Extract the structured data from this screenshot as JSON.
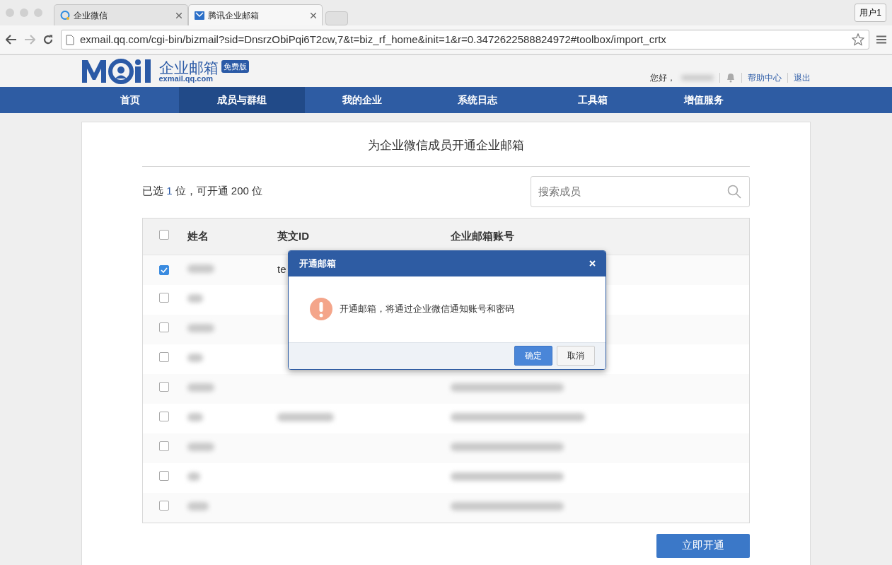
{
  "browser": {
    "tabs": [
      {
        "title": "企业微信",
        "selected": false
      },
      {
        "title": "腾讯企业邮箱",
        "selected": true
      }
    ],
    "profile_button": "用户1",
    "url": "exmail.qq.com/cgi-bin/bizmail?sid=DnsrzObiPqi6T2cw,7&t=biz_rf_home&init=1&r=0.3472622588824972#toolbox/import_crtx"
  },
  "header": {
    "logo_text": "企业邮箱",
    "logo_domain": "exmail.qq.com",
    "edition_badge": "免费版",
    "greeting": "您好，",
    "user_blurred": true,
    "links": [
      "帮助中心",
      "退出"
    ]
  },
  "nav": [
    {
      "label": "首页",
      "selected": false
    },
    {
      "label": "成员与群组",
      "selected": true
    },
    {
      "label": "我的企业",
      "selected": false
    },
    {
      "label": "系统日志",
      "selected": false
    },
    {
      "label": "工具箱",
      "selected": false
    },
    {
      "label": "增值服务",
      "selected": false
    }
  ],
  "page": {
    "title": "为企业微信成员开通企业邮箱",
    "counter": {
      "prefix": "已选 ",
      "selected_count": "1",
      "middle": " 位，可开通 ",
      "available": "200",
      "suffix": " 位"
    },
    "search": {
      "placeholder": "搜索成员"
    },
    "submit_button": "立即开通"
  },
  "table": {
    "select_all_checked": false,
    "columns": [
      "姓名",
      "英文ID",
      "企业邮箱账号"
    ],
    "rows": [
      {
        "checked": true,
        "name_blurred": true,
        "english_id": "te",
        "id_blurred": false,
        "email_blurred": false
      },
      {
        "checked": false,
        "name_blurred": true,
        "id_blurred": false,
        "email_blurred": false
      },
      {
        "checked": false,
        "name_blurred": true,
        "id_blurred": false,
        "email_blurred": false
      },
      {
        "checked": false,
        "name_blurred": true,
        "id_blurred": false,
        "email_blurred": false
      },
      {
        "checked": false,
        "name_blurred": true,
        "id_blurred": false,
        "email_blurred": true
      },
      {
        "checked": false,
        "name_blurred": true,
        "id_blurred": true,
        "email_blurred": true
      },
      {
        "checked": false,
        "name_blurred": true,
        "id_blurred": false,
        "email_blurred": true
      },
      {
        "checked": false,
        "name_blurred": true,
        "id_blurred": false,
        "email_blurred": true
      },
      {
        "checked": false,
        "name_blurred": true,
        "id_blurred": false,
        "email_blurred": true
      }
    ]
  },
  "dialog": {
    "title": "开通邮箱",
    "message": "开通邮箱，将通过企业微信通知账号和密码",
    "buttons": [
      {
        "label": "确定",
        "primary": true
      },
      {
        "label": "取消",
        "primary": false
      }
    ]
  }
}
